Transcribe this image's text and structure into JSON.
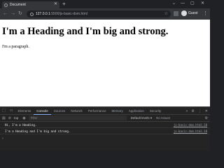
{
  "browser": {
    "tab_title": "Document",
    "new_tab_symbol": "+",
    "url_host": "127.0.0.1",
    "url_path": ":5500/js-basic-dom.html",
    "profile_name": "Guest"
  },
  "page": {
    "heading": "I'm a Heading and I'm big and strong.",
    "paragraph": "I'm a paragraph."
  },
  "devtools": {
    "tabs": [
      "Elements",
      "Console",
      "Sources",
      "Network",
      "Performance",
      "Memory",
      "Application",
      "Security"
    ],
    "active_tab": "Console",
    "context": "top",
    "filter_placeholder": "Filter",
    "levels": "Default levels ▾",
    "issues": "No Issues",
    "logs": [
      {
        "message": "Hi, I'm a Heading.",
        "source": "js-basic-dom.html:10"
      },
      {
        "message": "I'm a Heading and I'm big and strong.",
        "source": "js-basic-dom.html:10"
      }
    ]
  }
}
